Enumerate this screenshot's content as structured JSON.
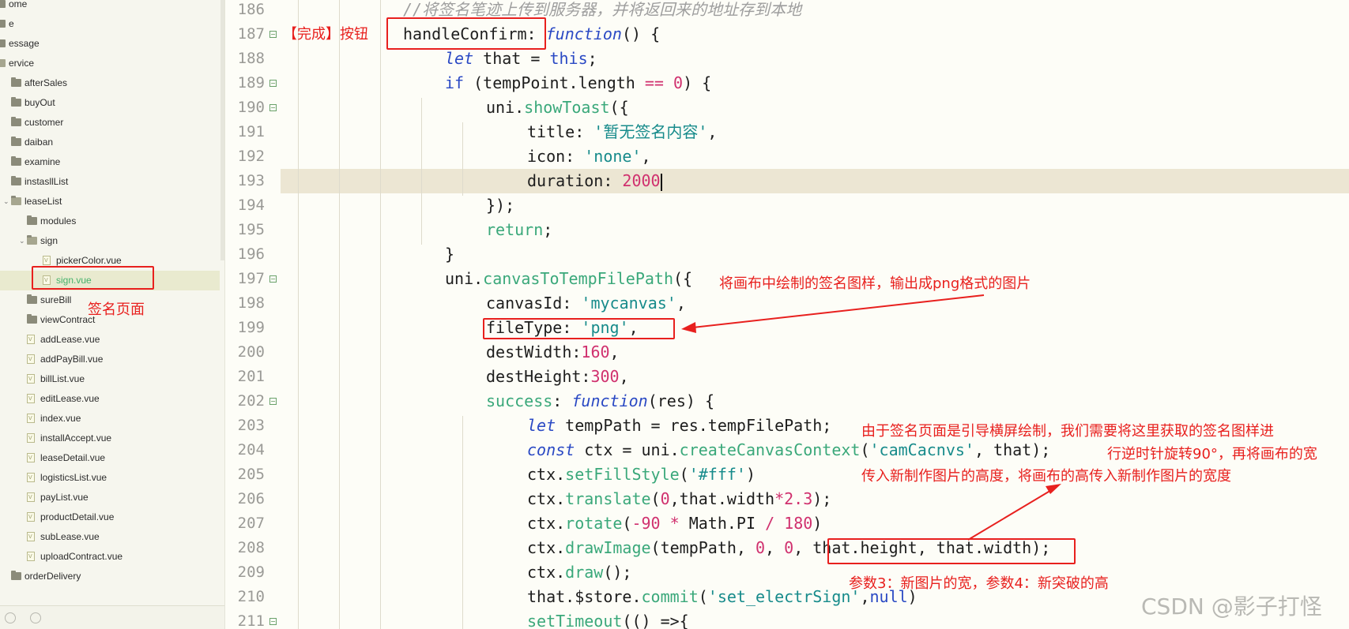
{
  "sidebar": {
    "items": [
      {
        "label": "ome",
        "type": "folder"
      },
      {
        "label": "e",
        "type": "folder"
      },
      {
        "label": "essage",
        "type": "folder"
      },
      {
        "label": "ervice",
        "type": "folder-open"
      },
      {
        "label": "afterSales",
        "type": "folder"
      },
      {
        "label": "buyOut",
        "type": "folder"
      },
      {
        "label": "customer",
        "type": "folder"
      },
      {
        "label": "daiban",
        "type": "folder"
      },
      {
        "label": "examine",
        "type": "folder"
      },
      {
        "label": "instasllList",
        "type": "folder"
      },
      {
        "label": "leaseList",
        "type": "folder-open"
      },
      {
        "label": "modules",
        "type": "folder"
      },
      {
        "label": "sign",
        "type": "folder-open"
      },
      {
        "label": "pickerColor.vue",
        "type": "file"
      },
      {
        "label": "sign.vue",
        "type": "file",
        "selected": true
      },
      {
        "label": "sureBill",
        "type": "folder"
      },
      {
        "label": "viewContract",
        "type": "folder"
      },
      {
        "label": "addLease.vue",
        "type": "file"
      },
      {
        "label": "addPayBill.vue",
        "type": "file"
      },
      {
        "label": "billList.vue",
        "type": "file"
      },
      {
        "label": "editLease.vue",
        "type": "file"
      },
      {
        "label": "index.vue",
        "type": "file"
      },
      {
        "label": "installAccept.vue",
        "type": "file"
      },
      {
        "label": "leaseDetail.vue",
        "type": "file"
      },
      {
        "label": "logisticsList.vue",
        "type": "file"
      },
      {
        "label": "payList.vue",
        "type": "file"
      },
      {
        "label": "productDetail.vue",
        "type": "file"
      },
      {
        "label": "subLease.vue",
        "type": "file"
      },
      {
        "label": "uploadContract.vue",
        "type": "file"
      },
      {
        "label": "orderDelivery",
        "type": "folder"
      }
    ],
    "bottom_icons": [
      "sync-icon",
      "globe-icon"
    ]
  },
  "editor": {
    "lines": [
      {
        "num": "186",
        "fold": false
      },
      {
        "num": "187",
        "fold": true
      },
      {
        "num": "188",
        "fold": false
      },
      {
        "num": "189",
        "fold": true
      },
      {
        "num": "190",
        "fold": true
      },
      {
        "num": "191",
        "fold": false
      },
      {
        "num": "192",
        "fold": false
      },
      {
        "num": "193",
        "fold": false,
        "current": true
      },
      {
        "num": "194",
        "fold": false
      },
      {
        "num": "195",
        "fold": false
      },
      {
        "num": "196",
        "fold": false
      },
      {
        "num": "197",
        "fold": true
      },
      {
        "num": "198",
        "fold": false
      },
      {
        "num": "199",
        "fold": false
      },
      {
        "num": "200",
        "fold": false
      },
      {
        "num": "201",
        "fold": false
      },
      {
        "num": "202",
        "fold": true
      },
      {
        "num": "203",
        "fold": false
      },
      {
        "num": "204",
        "fold": false
      },
      {
        "num": "205",
        "fold": false
      },
      {
        "num": "206",
        "fold": false
      },
      {
        "num": "207",
        "fold": false
      },
      {
        "num": "208",
        "fold": false
      },
      {
        "num": "209",
        "fold": false
      },
      {
        "num": "210",
        "fold": false
      },
      {
        "num": "211",
        "fold": true
      }
    ],
    "code": {
      "l186": "//将签名笔迹上传到服务器，并将返回来的地址存到本地",
      "l187_name": "handleConfirm:",
      "l187_kw": "function",
      "l187_rest": "() {",
      "l188_kw": "let",
      "l188_mid": " that = ",
      "l188_this": "this",
      "l188_end": ";",
      "l189_kw": "if",
      "l189_mid": " (tempPoint.length ",
      "l189_op": "==",
      "l189_sp": " ",
      "l189_num": "0",
      "l189_end": ") {",
      "l190_obj": "uni.",
      "l190_fn": "showToast",
      "l190_end": "({",
      "l191_key": "title: ",
      "l191_str": "'暂无签名内容'",
      "l191_end": ",",
      "l192_key": "icon: ",
      "l192_str": "'none'",
      "l192_end": ",",
      "l193_key": "duration: ",
      "l193_num": "2000",
      "l194": "});",
      "l195_kw": "return",
      "l195_end": ";",
      "l196": "}",
      "l197_obj": "uni.",
      "l197_fn": "canvasToTempFilePath",
      "l197_end": "({",
      "l198_key": "canvasId: ",
      "l198_str": "'mycanvas'",
      "l198_end": ",",
      "l199_key": "fileType: ",
      "l199_str": "'png'",
      "l199_end": ",",
      "l200_key": "destWidth:",
      "l200_num": "160",
      "l200_end": ",",
      "l201_key": "destHeight:",
      "l201_num": "300",
      "l201_end": ",",
      "l202_key": "success",
      "l202_colon": ": ",
      "l202_kw": "function",
      "l202_end": "(res) {",
      "l203_kw": "let",
      "l203_rest": " tempPath = res.tempFilePath;",
      "l204_kw": "const",
      "l204_mid": " ctx = uni.",
      "l204_fn": "createCanvasContext",
      "l204_open": "(",
      "l204_str": "'camCacnvs'",
      "l204_end": ", that);",
      "l205_obj": "ctx.",
      "l205_fn": "setFillStyle",
      "l205_open": "(",
      "l205_str": "'#fff'",
      "l205_end": ")",
      "l206_obj": "ctx.",
      "l206_fn": "translate",
      "l206_open": "(",
      "l206_n1": "0",
      "l206_mid": ",that.width",
      "l206_op": "*",
      "l206_n2": "2.3",
      "l206_end": ");",
      "l207_obj": "ctx.",
      "l207_fn": "rotate",
      "l207_open": "(",
      "l207_n1": "-90",
      "l207_mid1": " ",
      "l207_op1": "*",
      "l207_mid2": " Math.PI ",
      "l207_op2": "/",
      "l207_sp": " ",
      "l207_n2": "180",
      "l207_end": ")",
      "l208_obj": "ctx.",
      "l208_fn": "drawImage",
      "l208_open": "(tempPath, ",
      "l208_n1": "0",
      "l208_c1": ", ",
      "l208_n2": "0",
      "l208_end": ", that.height, that.width);",
      "l209_obj": "ctx.",
      "l209_fn": "draw",
      "l209_end": "();",
      "l210_obj": "that.$store.",
      "l210_fn": "commit",
      "l210_open": "(",
      "l210_str": "'set_electrSign'",
      "l210_comma": ",",
      "l210_null": "null",
      "l210_end": ")",
      "l211_fn": "setTimeout",
      "l211_end": "(() =>{"
    }
  },
  "annotations": {
    "confirm_button": "【完成】按钮",
    "sign_page": "签名页面",
    "canvas_export": "将画布中绘制的签名图样，输出成png格式的图片",
    "rotate_line1": "由于签名页面是引导横屏绘制，我们需要将这里获取的签名图样进",
    "rotate_line2": "行逆时针旋转90°，再将画布的宽",
    "rotate_line3": "传入新制作图片的高度，将画布的高传入新制作图片的宽度",
    "params_note": "参数3：新图片的宽，参数4：新突破的高",
    "color": "#e8201e"
  },
  "watermark": "CSDN @影子打怪"
}
